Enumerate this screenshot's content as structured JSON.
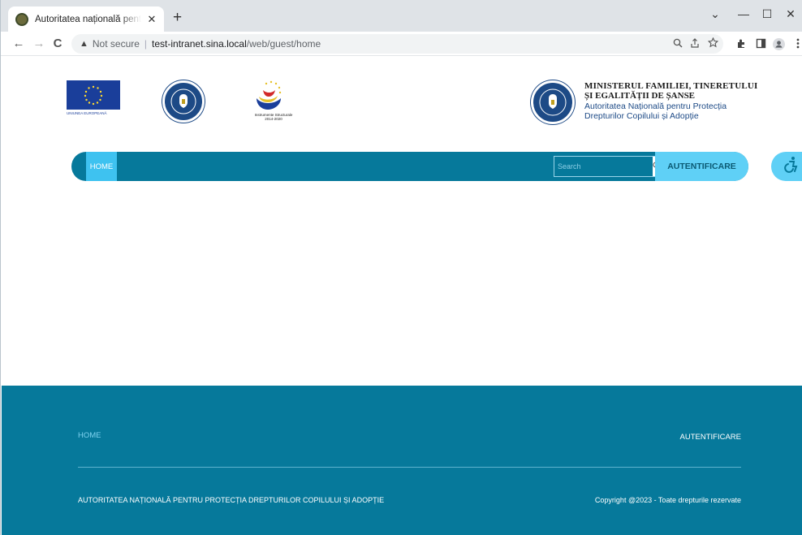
{
  "browser": {
    "tab_title": "Autoritatea națională pentru protecția drepturilor copilului și adopție",
    "tab_close": "✕",
    "new_tab": "+",
    "minimize": "—",
    "maximize": "☐",
    "close": "✕",
    "collapse": "⌄",
    "back": "←",
    "forward": "→",
    "reload": "C",
    "warning": "▲",
    "security_label": "Not secure",
    "separator": "|",
    "url_host": "test-intranet.sina.local",
    "url_path": "/web/guest/home"
  },
  "header": {
    "eu_caption": "UNIUNEA EUROPEANĂ",
    "instr_caption_1": "Instrumente Structurale",
    "instr_caption_2": "2014-2020",
    "ministry_line1": "MINISTERUL FAMILIEI, TINERETULUI",
    "ministry_line2": "ȘI EGALITĂȚII DE ȘANSE",
    "authority_line1": "Autoritatea Națională pentru Protecția",
    "authority_line2": "Drepturilor Copilului și Adopție"
  },
  "nav": {
    "home": "HOME",
    "search_placeholder": "Search",
    "search_icon": "⚲",
    "login": "AUTENTIFICARE",
    "accessibility_icon": "accessibility-icon"
  },
  "footer": {
    "home": "HOME",
    "login": "AUTENTIFICARE",
    "org": "AUTORITATEA NAȚIONALĂ PENTRU PROTECȚIA DREPTURILOR COPILULUI ȘI ADOPȚIE",
    "copyright": "Copyright @2023 - Toate drepturile rezervate"
  },
  "colors": {
    "primary": "#06799b",
    "accent": "#5fd0f6",
    "active": "#3ec2f0"
  }
}
